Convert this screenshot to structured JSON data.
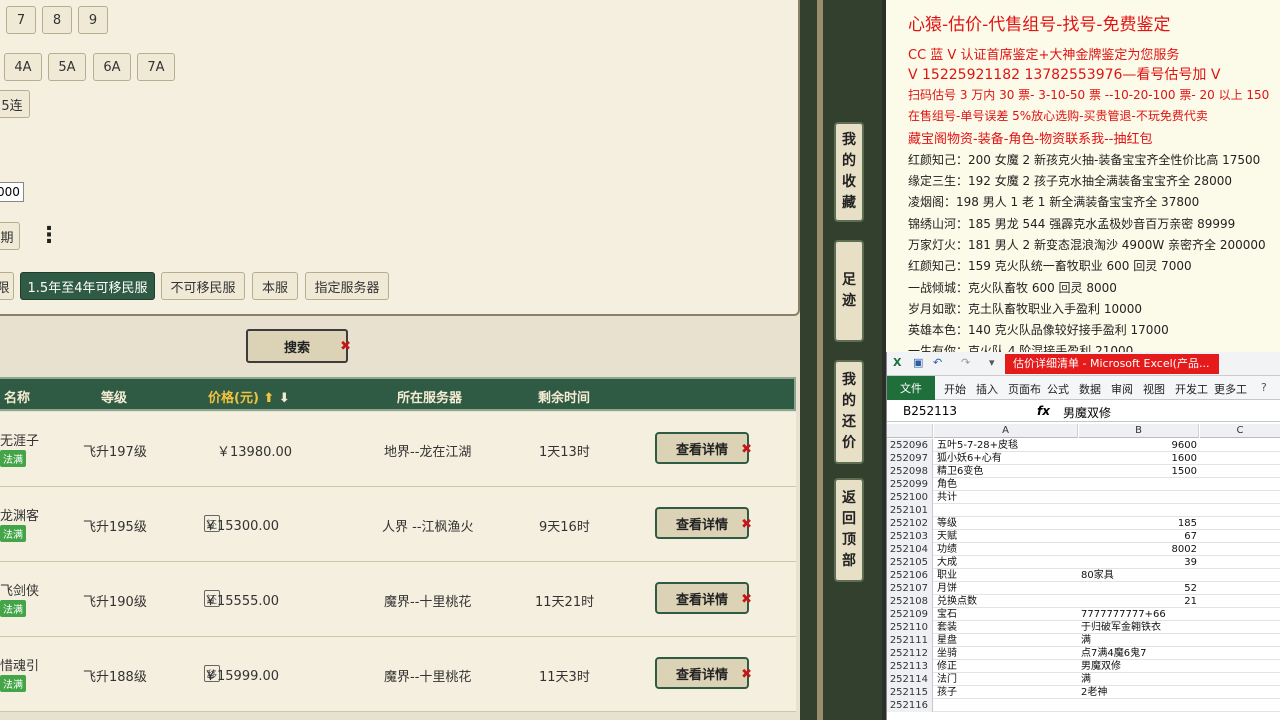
{
  "filter": {
    "digits": [
      "7",
      "8",
      "9"
    ],
    "chars": [
      "4A",
      "5A",
      "6A",
      "7A"
    ],
    "lian": "5连",
    "input_value": "000",
    "period": "期",
    "server_opts": [
      "限",
      "1.5年至4年可移民服",
      "不可移民服",
      "本服",
      "指定服务器"
    ]
  },
  "search_label": "搜索",
  "table": {
    "headers": {
      "name": "名称",
      "level": "等级",
      "price": "价格(元)",
      "server": "所在服务器",
      "remain": "剩余时间"
    },
    "detail_label": "查看详情",
    "rows": [
      {
        "name": "无涯子",
        "tag": "法满",
        "level": "飞升197级",
        "badge": "",
        "price": "￥13980.00",
        "server": "地界--龙在江湖",
        "remain": "1天13时"
      },
      {
        "name": "龙渊客",
        "tag": "法满",
        "level": "飞升195级",
        "badge": "还",
        "price": "￥15300.00",
        "server": "人界 --江枫渔火",
        "remain": "9天16时"
      },
      {
        "name": "飞剑侠",
        "tag": "法满",
        "level": "飞升190级",
        "badge": "还",
        "price": "￥15555.00",
        "server": "魔界--十里桃花",
        "remain": "11天21时"
      },
      {
        "name": "惜魂引",
        "tag": "法满",
        "level": "飞升188级",
        "badge": "移",
        "price": "￥15999.00",
        "server": "魔界--十里桃花",
        "remain": "11天3时"
      }
    ]
  },
  "side": [
    {
      "text": "我的收藏"
    },
    {
      "text": "足迹"
    },
    {
      "text": "我的还价"
    },
    {
      "text": "返回顶部"
    }
  ],
  "ad": {
    "title": "心猿-估价-代售组号-找号-免费鉴定",
    "lines": [
      "CC 蓝 V 认证首席鉴定+大神金牌鉴定为您服务",
      "V 15225921182      13782553976—看号估号加 V",
      "扫码估号 3 万内 30 票- 3-10-50 票  --10-20-100 票- 20 以上 150",
      "在售组号-单号误差 5%放心选购-买贵管退-不玩免费代卖",
      "藏宝阁物资-装备-角色-物资联系我--抽红包"
    ],
    "items": [
      "红颜知己：200 女魔 2 新孩克火抽-装备宝宝齐全性价比高 17500",
      "缘定三生：192 女魔 2 孩子克水抽全满装备宝宝齐全 28000",
      "凌烟阁：198 男人 1 老 1 新全满装备宝宝齐全 37800",
      "锦绣山河：185 男龙 544 强霹克水孟极妙音百万亲密 89999",
      "万家灯火：181 男人 2 新变态混浪淘沙 4900W 亲密齐全 200000",
      "红颜知己：159 克火队统一畜牧职业 600 回灵 7000",
      "一战倾城：克火队畜牧 600 回灵 8000",
      "岁月如歌：克土队畜牧职业入手盈利 10000",
      "英雄本色：140 克火队品像较好接手盈利 17000",
      "一生有你：克火队 4 阶混接手盈利 21000"
    ]
  },
  "excel": {
    "title": "估价详细清单 - Microsoft Excel(产品...",
    "menu": [
      "文件",
      "开始",
      "插入",
      "页面布",
      "公式",
      "数据",
      "审阅",
      "视图",
      "开发工",
      "更多工"
    ],
    "cell_ref": "B252113",
    "fx": "fx",
    "formula_value": "男魔双修",
    "cols": [
      "A",
      "B",
      "C"
    ],
    "rows": [
      {
        "n": "252096",
        "a": "五叶5-7-28+皮毯",
        "b": "9600",
        "num": true
      },
      {
        "n": "252097",
        "a": "狐小妖6+心有",
        "b": "1600",
        "num": true
      },
      {
        "n": "252098",
        "a": "精卫6变色",
        "b": "1500",
        "num": true
      },
      {
        "n": "252099",
        "a": "角色",
        "b": "",
        "num": false
      },
      {
        "n": "252100",
        "a": "共计",
        "b": "",
        "num": false
      },
      {
        "n": "252101",
        "a": "",
        "b": "",
        "num": false
      },
      {
        "n": "252102",
        "a": "等级",
        "b": "185",
        "num": true
      },
      {
        "n": "252103",
        "a": "天赋",
        "b": "67",
        "num": true
      },
      {
        "n": "252104",
        "a": "功绩",
        "b": "8002",
        "num": true
      },
      {
        "n": "252105",
        "a": "大成",
        "b": "39",
        "num": true
      },
      {
        "n": "252106",
        "a": "职业",
        "b": "80家具",
        "num": false
      },
      {
        "n": "252107",
        "a": "月饼",
        "b": "52",
        "num": true
      },
      {
        "n": "252108",
        "a": "兑换点数",
        "b": "21",
        "num": true
      },
      {
        "n": "252109",
        "a": "宝石",
        "b": "7777777777+66",
        "num": false
      },
      {
        "n": "252110",
        "a": "套装",
        "b": "于归破军金翱铁衣",
        "num": false
      },
      {
        "n": "252111",
        "a": "星盘",
        "b": "满",
        "num": false
      },
      {
        "n": "252112",
        "a": "坐骑",
        "b": "点7满4魔6鬼7",
        "num": false
      },
      {
        "n": "252113",
        "a": "修正",
        "b": "男魔双修",
        "num": false
      },
      {
        "n": "252114",
        "a": "法门",
        "b": "满",
        "num": false
      },
      {
        "n": "252115",
        "a": "孩子",
        "b": "2老神",
        "num": false
      },
      {
        "n": "252116",
        "a": "",
        "b": "",
        "num": false
      }
    ]
  }
}
